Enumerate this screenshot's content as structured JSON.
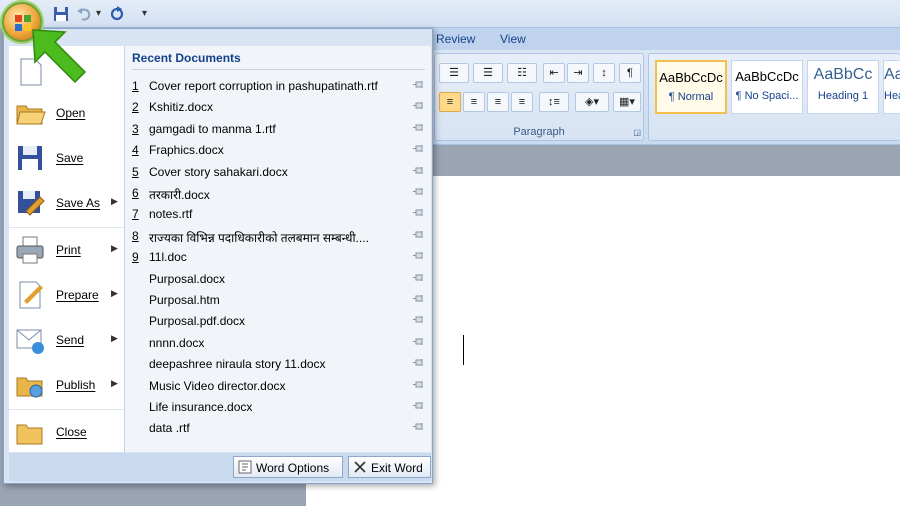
{
  "ribbon": {
    "tabs": [
      "Review",
      "View"
    ],
    "paragraph_label": "Paragraph",
    "styles": [
      {
        "sample": "AaBbCcDc",
        "name": "¶ Normal",
        "selected": true
      },
      {
        "sample": "AaBbCcDc",
        "name": "¶ No Spaci...",
        "selected": false
      },
      {
        "sample": "AaBbCc",
        "name": "Heading 1",
        "selected": false
      },
      {
        "sample": "AaBb",
        "name": "Hea",
        "selected": false
      }
    ]
  },
  "office_menu": {
    "items": [
      {
        "label": "New",
        "icon": "new-document-icon"
      },
      {
        "label": "Open",
        "icon": "open-folder-icon"
      },
      {
        "label": "Save",
        "icon": "save-icon"
      },
      {
        "label": "Save As",
        "icon": "save-as-icon",
        "submenu": true
      },
      {
        "label": "Print",
        "icon": "printer-icon",
        "submenu": true
      },
      {
        "label": "Prepare",
        "icon": "prepare-icon",
        "submenu": true
      },
      {
        "label": "Send",
        "icon": "send-icon",
        "submenu": true
      },
      {
        "label": "Publish",
        "icon": "publish-icon",
        "submenu": true
      },
      {
        "label": "Close",
        "icon": "close-folder-icon"
      }
    ],
    "recent_title": "Recent Documents",
    "recent": [
      {
        "num": "1",
        "name": "Cover report corruption in pashupatinath.rtf"
      },
      {
        "num": "2",
        "name": "Kshitiz.docx"
      },
      {
        "num": "3",
        "name": "gamgadi to manma 1.rtf"
      },
      {
        "num": "4",
        "name": "Fraphics.docx"
      },
      {
        "num": "5",
        "name": "Cover story sahakari.docx"
      },
      {
        "num": "6",
        "name": "तरकारी.docx"
      },
      {
        "num": "7",
        "name": "notes.rtf"
      },
      {
        "num": "8",
        "name": "राज्यका विभिन्न  पदाधिकारीको तलबमान सम्बन्धी...."
      },
      {
        "num": "9",
        "name": "11l.doc"
      },
      {
        "num": "",
        "name": "Purposal.docx"
      },
      {
        "num": "",
        "name": "Purposal.htm"
      },
      {
        "num": "",
        "name": "Purposal.pdf.docx"
      },
      {
        "num": "",
        "name": "nnnn.docx"
      },
      {
        "num": "",
        "name": "deepashree niraula story 11.docx"
      },
      {
        "num": "",
        "name": "Music Video director.docx"
      },
      {
        "num": "",
        "name": "Life insurance.docx"
      },
      {
        "num": "",
        "name": "data .rtf"
      }
    ],
    "word_options": "Word Options",
    "exit_word": "Exit Word"
  }
}
